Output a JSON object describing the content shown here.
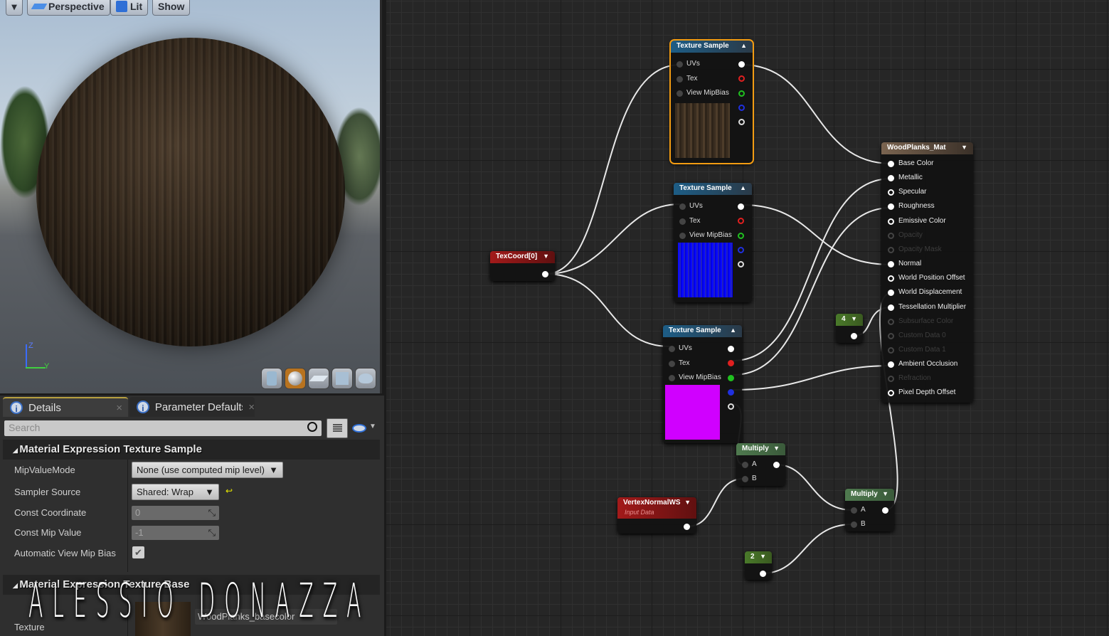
{
  "viewport": {
    "menu_label": "▾",
    "perspective": "Perspective",
    "lit": "Lit",
    "show": "Show",
    "axis_z": "Z",
    "axis_y": "Y"
  },
  "details": {
    "tabs": [
      {
        "label": "Details",
        "close": "×"
      },
      {
        "label": "Parameter Defaults",
        "close": "×"
      }
    ],
    "search_placeholder": "Search",
    "section1": "Material Expression Texture Sample",
    "props": [
      {
        "label": "MipValueMode",
        "value": "None (use computed mip level)"
      },
      {
        "label": "Sampler Source",
        "value": "Shared: Wrap"
      },
      {
        "label": "Const Coordinate",
        "value": "0"
      },
      {
        "label": "Const Mip Value",
        "value": "-1"
      },
      {
        "label": "Automatic View Mip Bias",
        "checked": true
      }
    ],
    "section2": "Material Expression Texture Base",
    "texture_label": "Texture",
    "texture_value": "WoodPlanks_basecolor"
  },
  "graph": {
    "texture_sample": {
      "title": "Texture Sample",
      "inputs": [
        "UVs",
        "Tex",
        "View MipBias"
      ]
    },
    "texcoord": "TexCoord[0]",
    "material": {
      "title": "WoodPlanks_Mat",
      "pins": [
        {
          "label": "Base Color",
          "on": true
        },
        {
          "label": "Metallic",
          "on": true
        },
        {
          "label": "Specular",
          "on": true
        },
        {
          "label": "Roughness",
          "on": true
        },
        {
          "label": "Emissive Color",
          "on": true
        },
        {
          "label": "Opacity",
          "on": false
        },
        {
          "label": "Opacity Mask",
          "on": false
        },
        {
          "label": "Normal",
          "on": true
        },
        {
          "label": "World Position Offset",
          "on": true
        },
        {
          "label": "World Displacement",
          "on": true
        },
        {
          "label": "Tessellation Multiplier",
          "on": true
        },
        {
          "label": "Subsurface Color",
          "on": false
        },
        {
          "label": "Custom Data 0",
          "on": false
        },
        {
          "label": "Custom Data 1",
          "on": false
        },
        {
          "label": "Ambient Occlusion",
          "on": true
        },
        {
          "label": "Refraction",
          "on": false
        },
        {
          "label": "Pixel Depth Offset",
          "on": true
        }
      ]
    },
    "const4": "4",
    "const2": "2",
    "multiply": {
      "title": "Multiply",
      "a": "A",
      "b": "B"
    },
    "vertex_normal": {
      "title": "VertexNormalWS",
      "subtitle": "Input Data"
    },
    "colors": {
      "selected": "#f39c12",
      "texture_header": "#1d5d86",
      "param_header": "#a31a1a",
      "math_header": "#4f7a4f",
      "const_header": "#4a7a2a"
    }
  },
  "watermark": "ALESSIO DONAZZA"
}
